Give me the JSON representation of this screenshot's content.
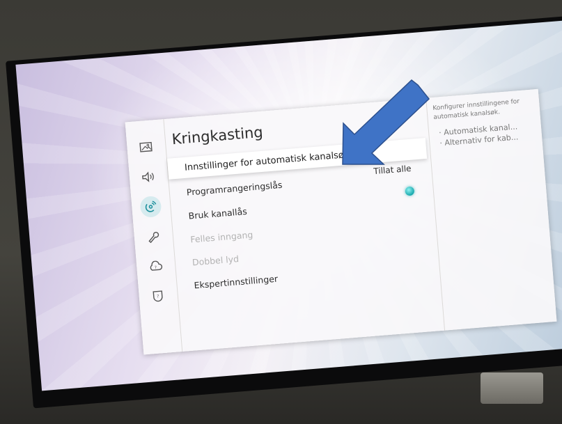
{
  "screen": {
    "title": "Kringkasting",
    "menu": [
      {
        "label": "Innstillinger for automatisk kanalsøk",
        "focused": true,
        "enabled": true
      },
      {
        "label": "Programrangeringslås",
        "value": "Tillat alle",
        "enabled": true
      },
      {
        "label": "Bruk kanallås",
        "enabled": true,
        "toggle_on": true
      },
      {
        "label": "Felles inngang",
        "enabled": false
      },
      {
        "label": "Dobbel lyd",
        "enabled": false
      },
      {
        "label": "Ekspertinnstillinger",
        "enabled": true
      }
    ],
    "description": "Konfigurer innstillingene for automatisk kanalsøk.",
    "desc_items": [
      "· Automatisk kanal...",
      "· Alternativ for kab..."
    ]
  },
  "sidebar_icons": [
    "picture-icon",
    "sound-icon",
    "broadcasting-icon",
    "general-icon",
    "support-icon",
    "privacy-icon"
  ],
  "colors": {
    "accent": "#1b8f9c",
    "arrow": "#3f73c6"
  }
}
